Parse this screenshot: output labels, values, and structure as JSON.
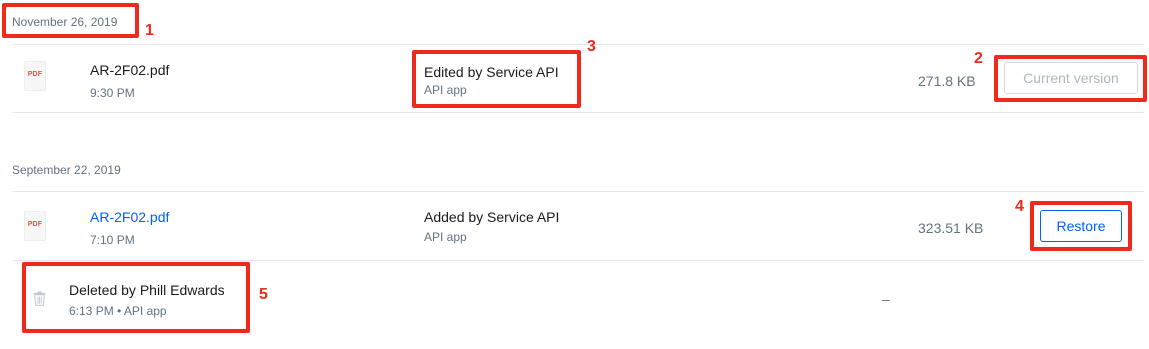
{
  "groups": [
    {
      "date": "November 26, 2019",
      "row": {
        "icon_label": "PDF",
        "file_name": "AR-2F02.pdf",
        "time": "9:30 PM",
        "action": "Edited by Service API",
        "app": "API app",
        "size": "271.8 KB",
        "button_label": "Current version"
      }
    },
    {
      "date": "September 22, 2019",
      "row": {
        "icon_label": "PDF",
        "file_name": "AR-2F02.pdf",
        "time": "7:10 PM",
        "action": "Added by Service API",
        "app": "API app",
        "size": "323.51 KB",
        "button_label": "Restore"
      }
    }
  ],
  "deleted_event": {
    "icon": "trash-icon",
    "title": "Deleted by Phill Edwards",
    "meta": "6:13 PM • API app",
    "size": "–"
  },
  "annotations": [
    "1",
    "2",
    "3",
    "4",
    "5"
  ],
  "colors": {
    "highlight": "#ee2a1c",
    "link": "#0061fe",
    "muted_text": "#637282"
  }
}
